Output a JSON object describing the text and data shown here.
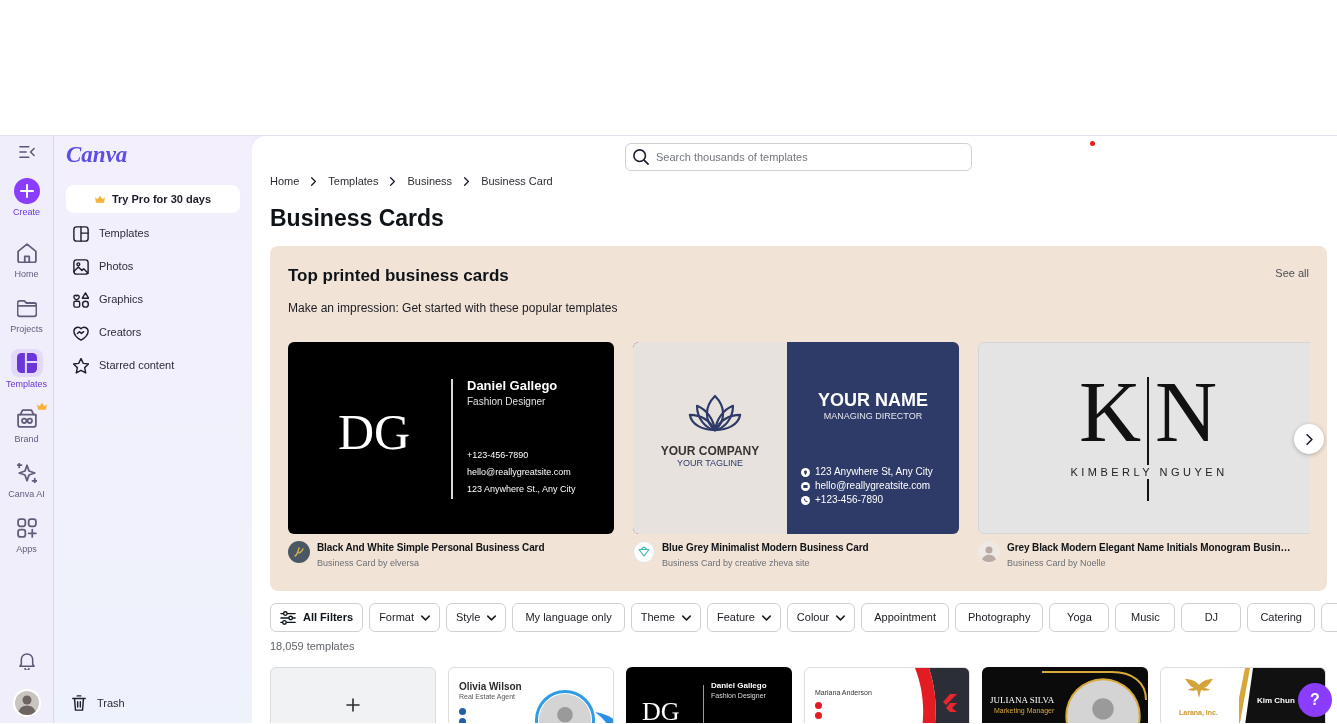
{
  "rail": {
    "items": [
      {
        "kind": "create",
        "label": "Create",
        "selected": false,
        "pro": false
      },
      {
        "kind": "home",
        "label": "Home",
        "selected": false,
        "pro": false
      },
      {
        "kind": "projects",
        "label": "Projects",
        "selected": false,
        "pro": false
      },
      {
        "kind": "templates",
        "label": "Templates",
        "selected": true,
        "pro": false
      },
      {
        "kind": "brand",
        "label": "Brand",
        "selected": false,
        "pro": true
      },
      {
        "kind": "ai",
        "label": "Canva AI",
        "selected": false,
        "pro": false
      },
      {
        "kind": "apps",
        "label": "Apps",
        "selected": false,
        "pro": false
      }
    ]
  },
  "sidebar": {
    "logo": "Canva",
    "promo_button": "Try Pro for 30 days",
    "items": [
      {
        "kind": "templates",
        "label": "Templates"
      },
      {
        "kind": "photos",
        "label": "Photos"
      },
      {
        "kind": "graphics",
        "label": "Graphics"
      },
      {
        "kind": "creators",
        "label": "Creators"
      },
      {
        "kind": "starred",
        "label": "Starred content"
      }
    ],
    "trash": "Trash"
  },
  "search": {
    "placeholder": "Search thousands of templates"
  },
  "breadcrumb": [
    "Home",
    "Templates",
    "Business",
    "Business Card"
  ],
  "title": "Business Cards",
  "featured": {
    "title": "Top printed business cards",
    "link": "See all",
    "subtitle": "Make an impression: Get started with these popular templates",
    "cards": [
      {
        "kind": "dark-monogram",
        "design": {
          "monogram": "DG",
          "name": "Daniel Gallego",
          "role": "Fashion Designer",
          "phone": "+123-456-7890",
          "email": "hello@reallygreatsite.com",
          "address": "123 Anywhere St., Any City"
        },
        "title": "Black And White Simple Personal Business Card",
        "byline": "Business Card by elversa"
      },
      {
        "kind": "split-navy",
        "design": {
          "company": "YOUR COMPANY",
          "tagline": "YOUR TAGLINE",
          "name": "YOUR NAME",
          "role": "MANAGING DIRECTOR",
          "address": "123 Anywhere St, Any City",
          "email": "hello@reallygreatsite.com",
          "phone": "+123-456-7890"
        },
        "title": "Blue Grey Minimalist Modern Business Card",
        "byline": "Business Card by creative zheva site"
      },
      {
        "kind": "grey-monogram",
        "design": {
          "initials": [
            "K",
            "N"
          ],
          "name": "KIMBERLY NGUYEN"
        },
        "title": "Grey Black Modern Elegant Name Initials Monogram Busin…",
        "byline": "Business Card by Noelle"
      }
    ]
  },
  "filters": {
    "chips": [
      {
        "kind": "all",
        "label": "All Filters"
      },
      {
        "kind": "dropdown",
        "label": "Format"
      },
      {
        "kind": "dropdown",
        "label": "Style"
      },
      {
        "kind": "tag",
        "label": "My language only"
      },
      {
        "kind": "dropdown",
        "label": "Theme"
      },
      {
        "kind": "dropdown",
        "label": "Feature"
      },
      {
        "kind": "dropdown",
        "label": "Colour"
      },
      {
        "kind": "tag",
        "label": "Appointment"
      },
      {
        "kind": "tag",
        "label": "Photography"
      },
      {
        "kind": "tag",
        "label": "Yoga"
      },
      {
        "kind": "tag",
        "label": "Music"
      },
      {
        "kind": "tag",
        "label": "DJ"
      },
      {
        "kind": "tag",
        "label": "Catering"
      },
      {
        "kind": "partial"
      }
    ],
    "count": "18,059 templates"
  },
  "templates": [
    {
      "kind": "blank"
    },
    {
      "kind": "agent",
      "name": "Olivia Wilson",
      "role": "Real Estate Agent"
    },
    {
      "kind": "dark-monogram",
      "monogram": "DG",
      "name": "Daniel Gallego",
      "role": "Fashion Designer"
    },
    {
      "kind": "red-wave",
      "name": "Mariana Anderson"
    },
    {
      "kind": "gold-photo",
      "name": "JULIANA SILVA",
      "role": "Marketing Manager"
    },
    {
      "kind": "gold-logo",
      "company": "Larana, Inc.",
      "name": "Kim Chun"
    }
  ],
  "help_button": "?"
}
